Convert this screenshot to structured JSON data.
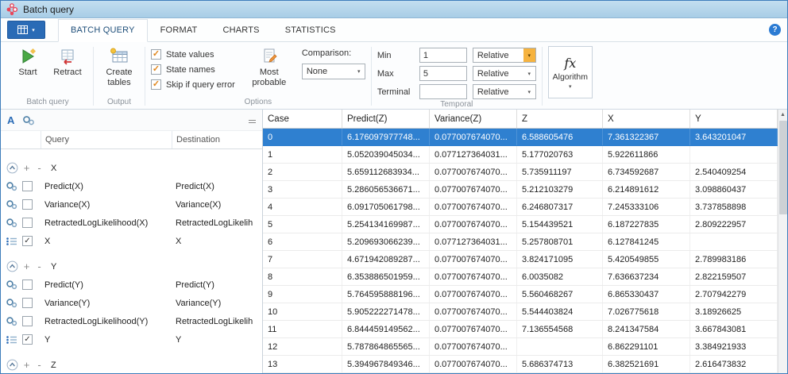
{
  "window": {
    "title": "Batch query"
  },
  "tabs": [
    {
      "label": "BATCH QUERY",
      "active": true
    },
    {
      "label": "FORMAT",
      "active": false
    },
    {
      "label": "CHARTS",
      "active": false
    },
    {
      "label": "STATISTICS",
      "active": false
    }
  ],
  "ribbon": {
    "start_label": "Start",
    "retract_label": "Retract",
    "batch_query_group_label": "Batch query",
    "create_tables_label": "Create tables",
    "output_group_label": "Output",
    "options": {
      "group_label": "Options",
      "checkboxes": [
        {
          "label": "State values",
          "checked": true
        },
        {
          "label": "State names",
          "checked": true
        },
        {
          "label": "Skip if query error",
          "checked": true
        }
      ],
      "most_probable_label": "Most probable",
      "comparison_label": "Comparison:",
      "comparison_value": "None"
    },
    "temporal": {
      "group_label": "Temporal",
      "rows": [
        {
          "label": "Min",
          "value": "1",
          "mode": "Relative",
          "highlight": true
        },
        {
          "label": "Max",
          "value": "5",
          "mode": "Relative",
          "highlight": false
        },
        {
          "label": "Terminal",
          "value": "",
          "mode": "Relative",
          "highlight": false
        }
      ]
    },
    "algorithm": {
      "icon_text": "fx",
      "label": "Algorithm"
    }
  },
  "query_panel": {
    "columns": {
      "query": "Query",
      "destination": "Destination"
    },
    "groups": [
      {
        "name": "X",
        "rows": [
          {
            "icon": "gear",
            "checked": false,
            "query": "Predict(X)",
            "destination": "Predict(X)"
          },
          {
            "icon": "gear",
            "checked": false,
            "query": "Variance(X)",
            "destination": "Variance(X)"
          },
          {
            "icon": "gear",
            "checked": false,
            "query": "RetractedLogLikelihood(X)",
            "destination": "RetractedLogLikelih"
          },
          {
            "icon": "list",
            "checked": true,
            "query": "X",
            "destination": "X"
          }
        ]
      },
      {
        "name": "Y",
        "rows": [
          {
            "icon": "gear",
            "checked": false,
            "query": "Predict(Y)",
            "destination": "Predict(Y)"
          },
          {
            "icon": "gear",
            "checked": false,
            "query": "Variance(Y)",
            "destination": "Variance(Y)"
          },
          {
            "icon": "gear",
            "checked": false,
            "query": "RetractedLogLikelihood(Y)",
            "destination": "RetractedLogLikelih"
          },
          {
            "icon": "list",
            "checked": true,
            "query": "Y",
            "destination": "Y"
          }
        ]
      },
      {
        "name": "Z",
        "rows": []
      }
    ]
  },
  "results": {
    "columns": [
      "Case",
      "Predict(Z)",
      "Variance(Z)",
      "Z",
      "X",
      "Y"
    ],
    "selected_index": 0,
    "rows": [
      [
        "0",
        "6.176097977748...",
        "0.077007674070...",
        "6.588605476",
        "7.361322367",
        "3.643201047"
      ],
      [
        "1",
        "5.052039045034...",
        "0.077127364031...",
        "5.177020763",
        "5.922611866",
        ""
      ],
      [
        "2",
        "5.659112683934...",
        "0.077007674070...",
        "5.735911197",
        "6.734592687",
        "2.540409254"
      ],
      [
        "3",
        "5.286056536671...",
        "0.077007674070...",
        "5.212103279",
        "6.214891612",
        "3.098860437"
      ],
      [
        "4",
        "6.091705061798...",
        "0.077007674070...",
        "6.246807317",
        "7.245333106",
        "3.737858898"
      ],
      [
        "5",
        "5.254134169987...",
        "0.077007674070...",
        "5.154439521",
        "6.187227835",
        "2.809222957"
      ],
      [
        "6",
        "5.209693066239...",
        "0.077127364031...",
        "5.257808701",
        "6.127841245",
        ""
      ],
      [
        "7",
        "4.671942089287...",
        "0.077007674070...",
        "3.824171095",
        "5.420549855",
        "2.789983186"
      ],
      [
        "8",
        "6.353886501959...",
        "0.077007674070...",
        "6.0035082",
        "7.636637234",
        "2.822159507"
      ],
      [
        "9",
        "5.764595888196...",
        "0.077007674070...",
        "5.560468267",
        "6.865330437",
        "2.707942279"
      ],
      [
        "10",
        "5.905222271478...",
        "0.077007674070...",
        "5.544403824",
        "7.026775618",
        "3.18926625"
      ],
      [
        "11",
        "6.844459149562...",
        "0.077007674070...",
        "7.136554568",
        "8.241347584",
        "3.667843081"
      ],
      [
        "12",
        "5.787864865565...",
        "0.077007674070...",
        "",
        "6.862291101",
        "3.384921933"
      ],
      [
        "13",
        "5.394967849346...",
        "0.077007674070...",
        "5.686374713",
        "6.382521691",
        "2.616473832"
      ]
    ]
  }
}
